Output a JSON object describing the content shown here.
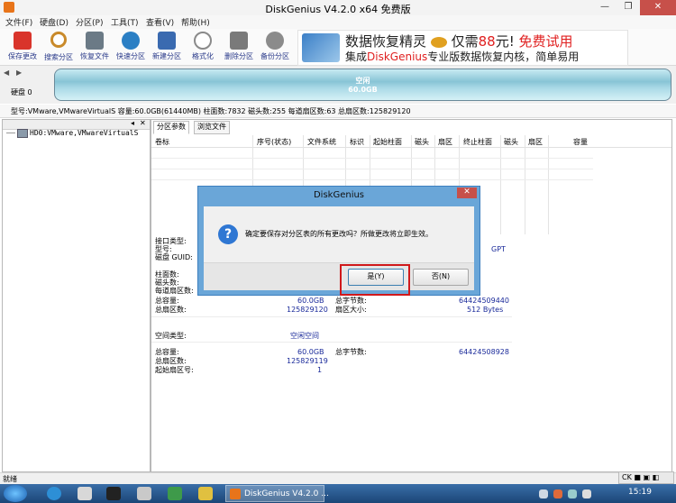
{
  "window": {
    "title": "DiskGenius V4.2.0 x64 免费版",
    "min": "—",
    "max": "❐",
    "close": "✕"
  },
  "menu": [
    "文件(F)",
    "硬盘(D)",
    "分区(P)",
    "工具(T)",
    "查看(V)",
    "帮助(H)"
  ],
  "toolbar": [
    {
      "label": "保存更改",
      "icon": "save-icon",
      "color": "#d9342b"
    },
    {
      "label": "搜索分区",
      "icon": "magnifier-icon",
      "color": "#c98a2a"
    },
    {
      "label": "恢复文件",
      "icon": "disk-recover-icon",
      "color": "#6b7a86"
    },
    {
      "label": "快速分区",
      "icon": "quick-partition-icon",
      "color": "#2b7fc4"
    },
    {
      "label": "新建分区",
      "icon": "new-partition-icon",
      "color": "#3a6ab0"
    },
    {
      "label": "格式化",
      "icon": "format-icon",
      "color": "#8a8a8a"
    },
    {
      "label": "删除分区",
      "icon": "trash-icon",
      "color": "#7a7a7a"
    },
    {
      "label": "备份分区",
      "icon": "backup-icon",
      "color": "#8b8b8b"
    }
  ],
  "banner": {
    "line1_a": "数据恢复精灵",
    "line1_b": "仅需",
    "line1_price": "88",
    "line1_c": "元!",
    "line1_d": "免费试用",
    "line2_a": "集成",
    "line2_b": "DiskGenius",
    "line2_c": "专业版数据恢复内核，简单易用"
  },
  "disk_nav": {
    "back": "◀",
    "forward": "▶",
    "disk_label": "硬盘 0"
  },
  "disk_bar": {
    "line1": "空闲",
    "line2": "60.0GB"
  },
  "info_line": "型号:VMware,VMwareVirtualS  容量:60.0GB(61440MB)  柱面数:7832  磁头数:255  每道扇区数:63  总扇区数:125829120",
  "tree": {
    "item": "HD0:VMware,VMwareVirtualS"
  },
  "tabs": [
    "分区参数",
    "浏览文件"
  ],
  "columns": [
    "卷标",
    "序号(状态)",
    "文件系统",
    "标识",
    "起始柱面",
    "磁头",
    "扇区",
    "终止柱面",
    "磁头",
    "扇区",
    "容量"
  ],
  "details": {
    "interface_type_label": "接口类型:",
    "model_label": "型号:",
    "guid_label": "磁盘 GUID:",
    "partition_style": "GPT",
    "cylinders_label": "柱面数:",
    "heads_label": "磁头数:",
    "sectors_label": "每道扇区数:",
    "capacity_label": "总容量:",
    "capacity_value": "60.0GB",
    "total_bytes_label": "总字节数:",
    "total_bytes_value": "64424509440",
    "total_sectors_label": "总扇区数:",
    "total_sectors_value": "125829120",
    "sector_size_label": "扇区大小:",
    "sector_size_value": "512 Bytes",
    "space_type_label": "空间类型:",
    "space_type_value": "空闲空间",
    "free_capacity_label": "总容量:",
    "free_capacity_value": "60.0GB",
    "free_bytes_label": "总字节数:",
    "free_bytes_value": "64424508928",
    "free_sectors_label": "总扇区数:",
    "free_sectors_value": "125829119",
    "start_sector_label": "起始扇区号:",
    "start_sector_value": "1"
  },
  "dialog": {
    "title": "DiskGenius",
    "close": "✕",
    "message": "确定要保存对分区表的所有更改吗？所做更改将立即生效。",
    "yes": "是(Y)",
    "no": "否(N)"
  },
  "status": {
    "text": "就绪"
  },
  "ime": {
    "text": "CK ■ ▣ ◧"
  },
  "taskbar": {
    "app": "DiskGenius V4.2.0 ...",
    "time": "15:19"
  }
}
